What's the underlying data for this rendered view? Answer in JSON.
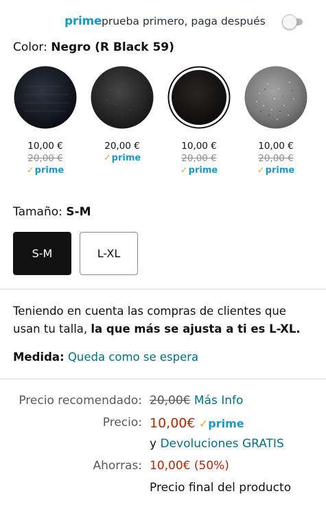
{
  "prime_banner": {
    "logo_text": "prime",
    "tagline": "prueba primero, paga después",
    "toggle_on": false
  },
  "color": {
    "label": "Color:",
    "value": "Negro (R Black 59)"
  },
  "swatches": [
    {
      "price": "10,00 €",
      "original": "20,00 €",
      "prime": "prime",
      "selected": false,
      "color": "#1c1f26"
    },
    {
      "price": "20,00 €",
      "original": "",
      "prime": "prime",
      "selected": false,
      "color": "#2b2b2b"
    },
    {
      "price": "10,00 €",
      "original": "20,00 €",
      "prime": "prime",
      "selected": true,
      "color": "#161414"
    },
    {
      "price": "10,00 €",
      "original": "20,00 €",
      "prime": "prime",
      "selected": false,
      "color": "#8a8a8a"
    }
  ],
  "size": {
    "label": "Tamaño:",
    "value": "S-M",
    "options": [
      "S-M",
      "L-XL"
    ]
  },
  "fit": {
    "text_prefix": "Teniendo en cuenta las compras de clientes que usan tu talla, ",
    "text_bold": "la que más se ajusta a ti es L-XL.",
    "measure_label": "Medida:",
    "measure_value": "Queda como se espera"
  },
  "pricing": {
    "recommended_label": "Precio recomendado:",
    "recommended_value": "20,00€",
    "more_info": "Más Info",
    "price_label": "Precio:",
    "price_value": "10,00€",
    "prime": "prime",
    "returns_prefix": "y",
    "returns_link": "Devoluciones GRATIS",
    "savings_label": "Ahorras:",
    "savings_value": "10,00€ (50%)",
    "final_note": "Precio final del producto"
  },
  "colors": {
    "prime_blue": "#1a98c7",
    "link_teal": "#007185",
    "price_red": "#b12704",
    "check_orange": "#f5a623"
  }
}
